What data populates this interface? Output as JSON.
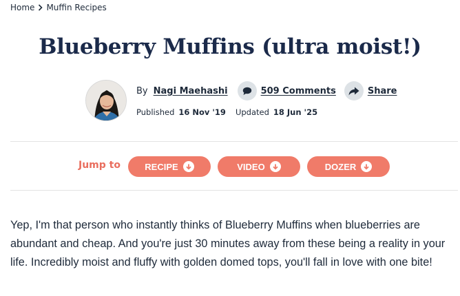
{
  "breadcrumb": {
    "home": "Home",
    "current": "Muffin Recipes"
  },
  "recipe": {
    "title": "Blueberry Muffins (ultra moist!)"
  },
  "meta": {
    "by_label": "By",
    "author": "Nagi Maehashi",
    "comments": "509 Comments",
    "share": "Share",
    "published_label": "Published",
    "published_date": "16 Nov '19",
    "updated_label": "Updated",
    "updated_date": "18 Jun '25"
  },
  "jump": {
    "label": "Jump to",
    "buttons": [
      "RECIPE",
      "VIDEO",
      "DOZER"
    ]
  },
  "intro": {
    "text": "Yep, I'm that person who instantly thinks of Blueberry Muffins when blueberries are abundant and cheap. And you're just 30 minutes away from these being a reality in your life. Incredibly moist and fluffy with golden domed tops, you'll fall in love with one bite!"
  },
  "colors": {
    "accent": "#f07b69",
    "jump_label": "#e96e5e",
    "title": "#1b2a4a",
    "icon_bg": "#dde2e6"
  },
  "icons": {
    "breadcrumb_separator": "chevron-right-icon",
    "comments": "speech-bubble-icon",
    "share": "share-arrow-icon",
    "jump_arrow": "arrow-down-circle-icon"
  }
}
